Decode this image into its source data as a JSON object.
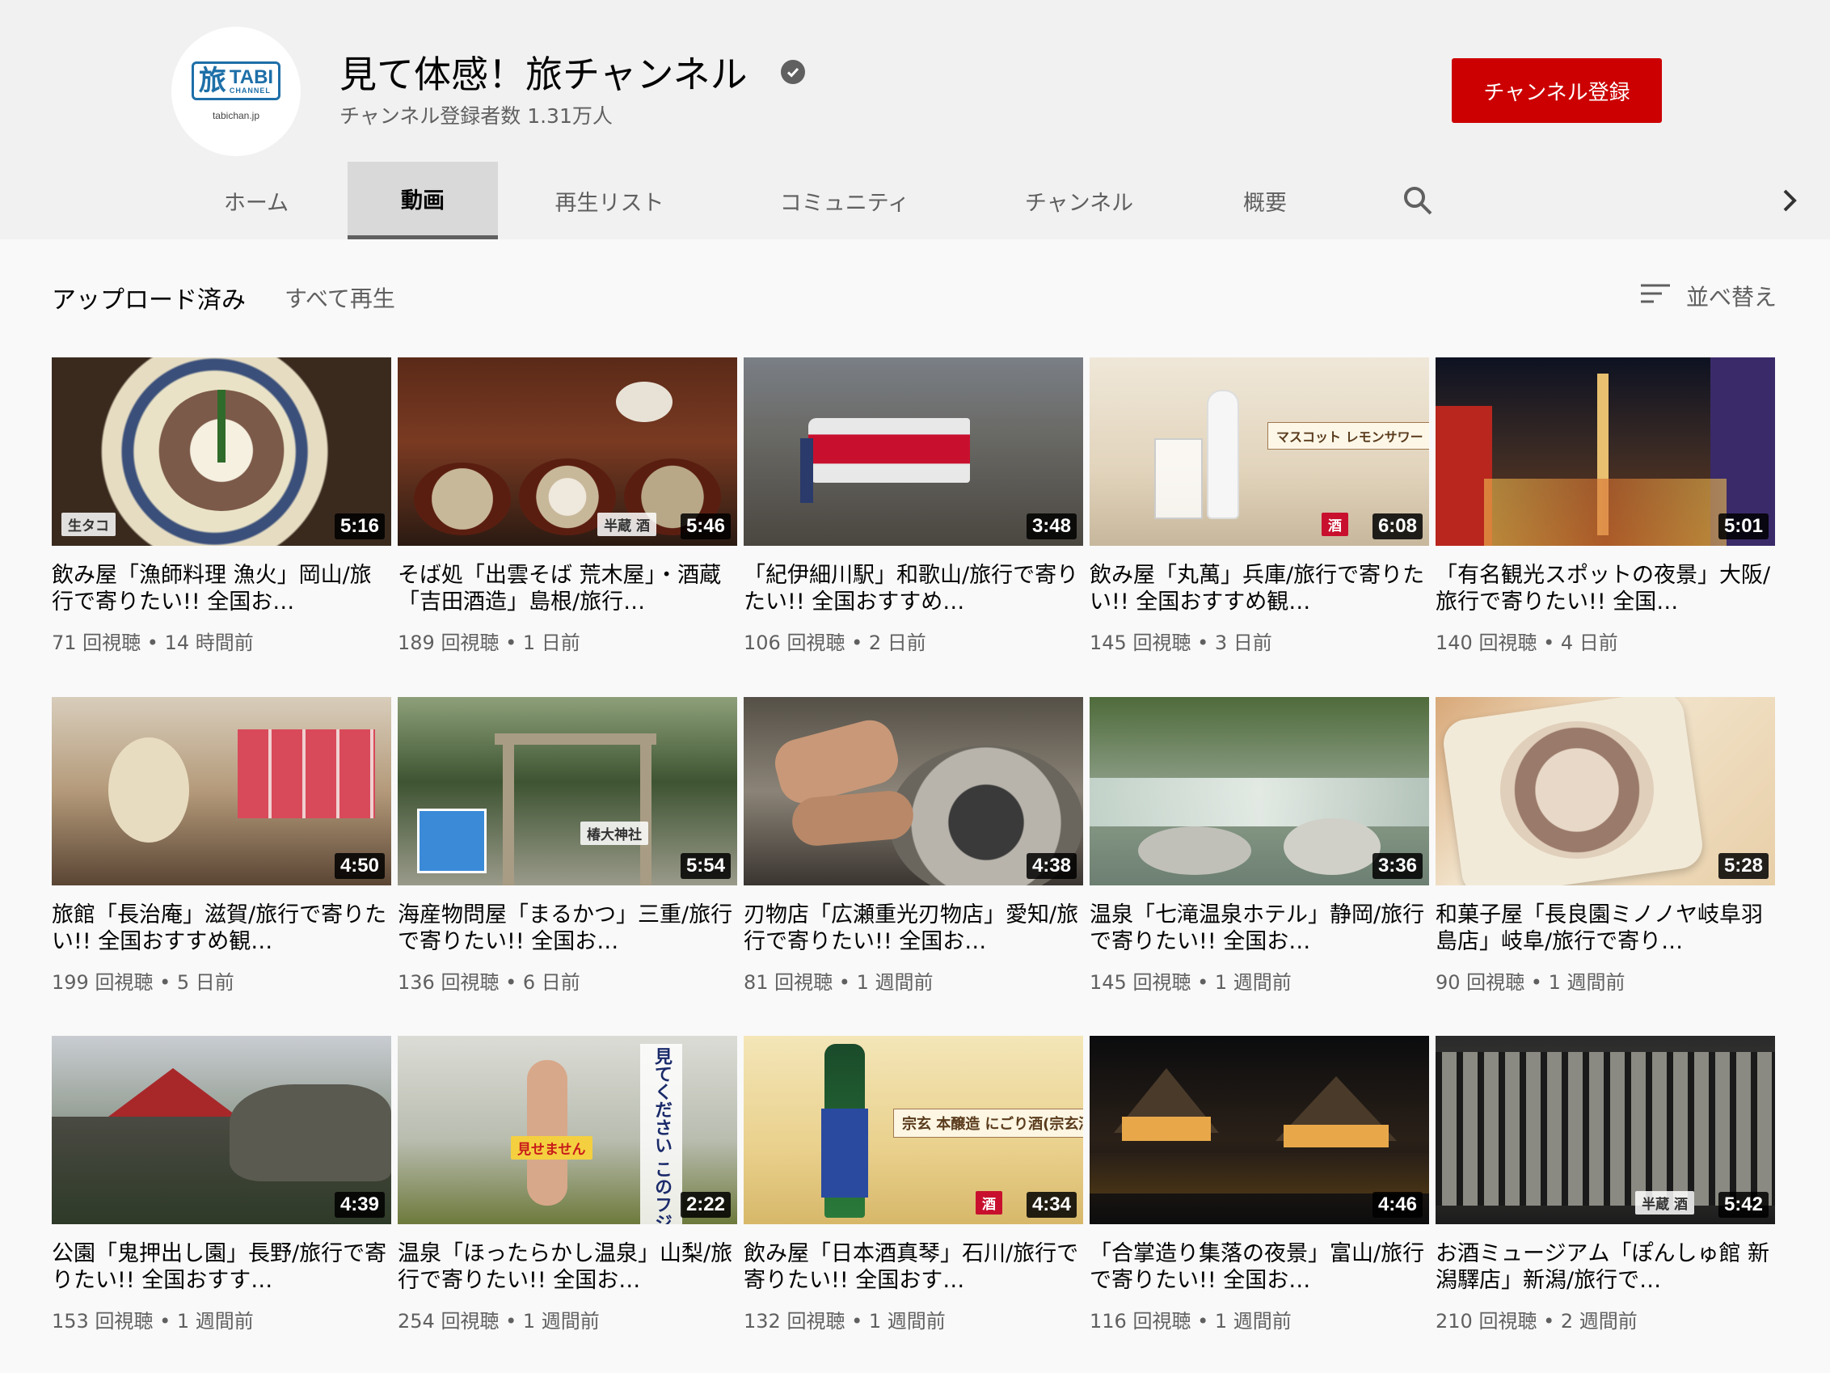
{
  "channel": {
    "name": "見て体感！旅チャンネル",
    "subscribers": "チャンネル登録者数 1.31万人",
    "avatar": {
      "kanji": "旅",
      "word": "TABI",
      "sub": "CHANNEL",
      "domain": "tabichan.jp"
    },
    "subscribe_label": "チャンネル登録"
  },
  "tabs": [
    {
      "label": "ホーム",
      "active": false
    },
    {
      "label": "動画",
      "active": true
    },
    {
      "label": "再生リスト",
      "active": false
    },
    {
      "label": "コミュニティ",
      "active": false
    },
    {
      "label": "チャンネル",
      "active": false
    },
    {
      "label": "概要",
      "active": false
    }
  ],
  "section": {
    "title": "アップロード済み",
    "play_all": "すべて再生",
    "sort_label": "並べ替え"
  },
  "videos": [
    {
      "title": "飲み屋「漁師料理 漁火」岡山/旅行で寄りたい!! 全国お…",
      "views": "71 回視聴",
      "age": "14 時間前",
      "duration": "5:16",
      "tag": "生タコ"
    },
    {
      "title": "そば処「出雲そば 荒木屋」・酒蔵「吉田酒造」島根/旅行…",
      "views": "189 回視聴",
      "age": "1 日前",
      "duration": "5:46",
      "tag": "半蔵 酒"
    },
    {
      "title": "「紀伊細川駅」和歌山/旅行で寄りたい!! 全国おすすめ…",
      "views": "106 回視聴",
      "age": "2 日前",
      "duration": "3:48",
      "tag": ""
    },
    {
      "title": "飲み屋「丸萬」兵庫/旅行で寄りたい!! 全国おすすめ観…",
      "views": "145 回視聴",
      "age": "3 日前",
      "duration": "6:08",
      "tag": "酒",
      "caption": "マスコット レモンサワー（兵庫鉱泉所）"
    },
    {
      "title": "「有名観光スポットの夜景」大阪/旅行で寄りたい!! 全国…",
      "views": "140 回視聴",
      "age": "4 日前",
      "duration": "5:01",
      "tag": ""
    },
    {
      "title": "旅館「長治庵」滋賀/旅行で寄りたい!! 全国おすすめ観…",
      "views": "199 回視聴",
      "age": "5 日前",
      "duration": "4:50",
      "tag": ""
    },
    {
      "title": "海産物問屋「まるかつ」三重/旅行で寄りたい!! 全国お…",
      "views": "136 回視聴",
      "age": "6 日前",
      "duration": "5:54",
      "tag": "椿大神社"
    },
    {
      "title": "刃物店「広瀬重光刃物店」愛知/旅行で寄りたい!! 全国お…",
      "views": "81 回視聴",
      "age": "1 週間前",
      "duration": "4:38",
      "tag": ""
    },
    {
      "title": "温泉「七滝温泉ホテル」静岡/旅行で寄りたい!! 全国お…",
      "views": "145 回視聴",
      "age": "1 週間前",
      "duration": "3:36",
      "tag": ""
    },
    {
      "title": "和菓子屋「長良園ミノノヤ岐阜羽島店」岐阜/旅行で寄り…",
      "views": "90 回視聴",
      "age": "1 週間前",
      "duration": "5:28",
      "tag": ""
    },
    {
      "title": "公園「鬼押出し園」長野/旅行で寄りたい!! 全国おすす…",
      "views": "153 回視聴",
      "age": "1 週間前",
      "duration": "4:39",
      "tag": ""
    },
    {
      "title": "温泉「ほったらかし温泉」山梨/旅行で寄りたい!! 全国お…",
      "views": "254 回視聴",
      "age": "1 週間前",
      "duration": "2:22",
      "tag": "見せません",
      "caption": "見てください このフジツボ"
    },
    {
      "title": "飲み屋「日本酒真琴」石川/旅行で寄りたい!! 全国おす…",
      "views": "132 回視聴",
      "age": "1 週間前",
      "duration": "4:34",
      "tag": "酒",
      "caption": "宗玄 本醸造 にごり酒(宗玄酒造)"
    },
    {
      "title": "「合掌造り集落の夜景」富山/旅行で寄りたい!! 全国お…",
      "views": "116 回視聴",
      "age": "1 週間前",
      "duration": "4:46",
      "tag": ""
    },
    {
      "title": "お酒ミュージアム「ぽんしゅ館 新潟驛店」新潟/旅行で…",
      "views": "210 回視聴",
      "age": "2 週間前",
      "duration": "5:42",
      "tag": "半蔵 酒"
    }
  ],
  "colors": {
    "subscribe": "#cc0000",
    "tab_active_bg": "#d9d9d9",
    "header_bg": "#f1f1f1",
    "page_bg": "#f9f9f9"
  },
  "icons": {
    "verified": "check-circle-icon",
    "search": "search-icon",
    "next": "chevron-right-icon",
    "sort": "sort-icon"
  }
}
